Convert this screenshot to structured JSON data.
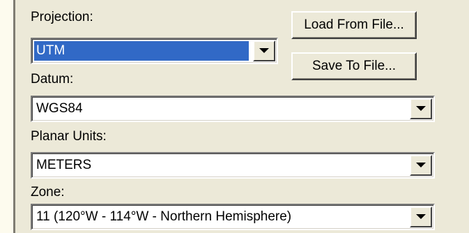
{
  "projection": {
    "label": "Projection:",
    "value": "UTM"
  },
  "buttons": {
    "load": "Load From File...",
    "save": "Save To File..."
  },
  "datum": {
    "label": "Datum:",
    "value": "WGS84"
  },
  "planar_units": {
    "label": "Planar Units:",
    "value": "METERS"
  },
  "zone": {
    "label": "Zone:",
    "value": "11 (120°W - 114°W - Northern Hemisphere)"
  },
  "icons": {
    "dropdown": "chevron-down-icon"
  },
  "colors": {
    "panel": "#ece9d8",
    "selection": "#3169c6",
    "outer_background": "#fdfbee"
  }
}
